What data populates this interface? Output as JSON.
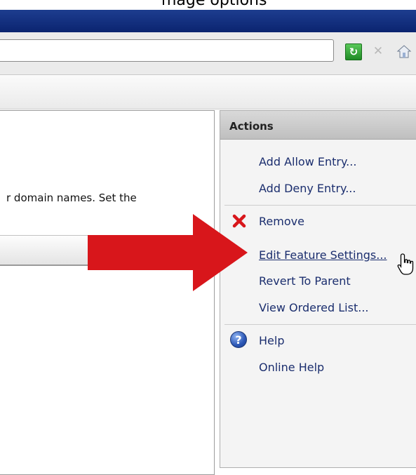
{
  "caption": {
    "text": "mage options"
  },
  "toolbar": {
    "refresh_icon": "refresh-icon",
    "stop_icon": "stop-icon",
    "home_icon": "home-icon"
  },
  "content": {
    "description": "r domain names. Set the"
  },
  "actions": {
    "title": "Actions",
    "group1": {
      "add_allow": "Add Allow Entry...",
      "add_deny": "Add Deny Entry..."
    },
    "group2": {
      "remove": "Remove",
      "edit_feature_settings": "Edit Feature Settings...",
      "revert_to_parent": "Revert To Parent",
      "view_ordered_list": "View Ordered List..."
    },
    "group3": {
      "help": "Help",
      "online_help": "Online Help"
    }
  },
  "colors": {
    "title_bar": "#0b2470",
    "link": "#1b2e6e",
    "arrow": "#d8161b",
    "remove_x": "#d8161b"
  }
}
